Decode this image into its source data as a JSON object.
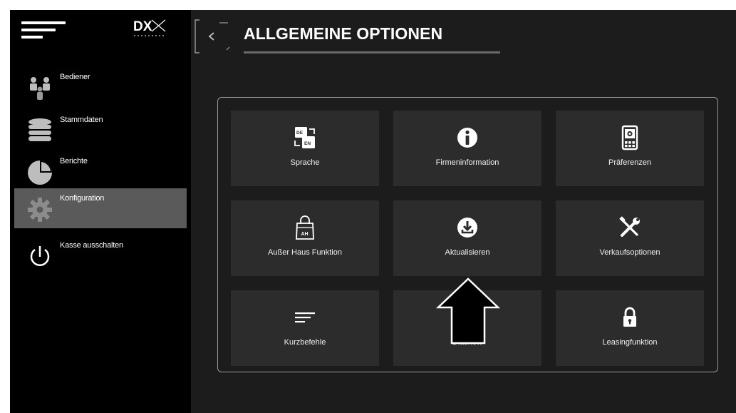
{
  "header": {
    "title": "ALLGEMEINE OPTIONEN"
  },
  "sidebar": {
    "logo_text": "DX",
    "items": [
      {
        "label": "Bediener",
        "icon": "users-icon",
        "active": false
      },
      {
        "label": "Stammdaten",
        "icon": "database-icon",
        "active": false
      },
      {
        "label": "Berichte",
        "icon": "pie-chart-icon",
        "active": false
      },
      {
        "label": "Konfiguration",
        "icon": "gear-icon",
        "active": true
      },
      {
        "label": "Kasse ausschalten",
        "icon": "power-icon",
        "active": false
      }
    ]
  },
  "tiles": [
    {
      "label": "Sprache",
      "icon": "language-icon"
    },
    {
      "label": "Firmeninformation",
      "icon": "info-icon"
    },
    {
      "label": "Präferenzen",
      "icon": "preferences-icon"
    },
    {
      "label": "Außer Haus Funktion",
      "icon": "takeaway-bag-icon"
    },
    {
      "label": "Aktualisieren",
      "icon": "update-download-icon"
    },
    {
      "label": "Verkaufsoptionen",
      "icon": "tools-icon"
    },
    {
      "label": "Kurzbefehle",
      "icon": "shortcuts-lines-icon"
    },
    {
      "label": "Diashow",
      "icon": "slideshow-icon"
    },
    {
      "label": "Leasingfunktion",
      "icon": "lock-icon"
    }
  ],
  "language_icon": {
    "from": "DE",
    "to": "EN"
  },
  "takeaway_icon_text": "AH",
  "colors": {
    "background": "#1c1c1c",
    "sidebar": "#000000",
    "active_item": "#5a5a5a",
    "tile": "#2c2c2c",
    "panel_border": "#9a9a9a"
  }
}
